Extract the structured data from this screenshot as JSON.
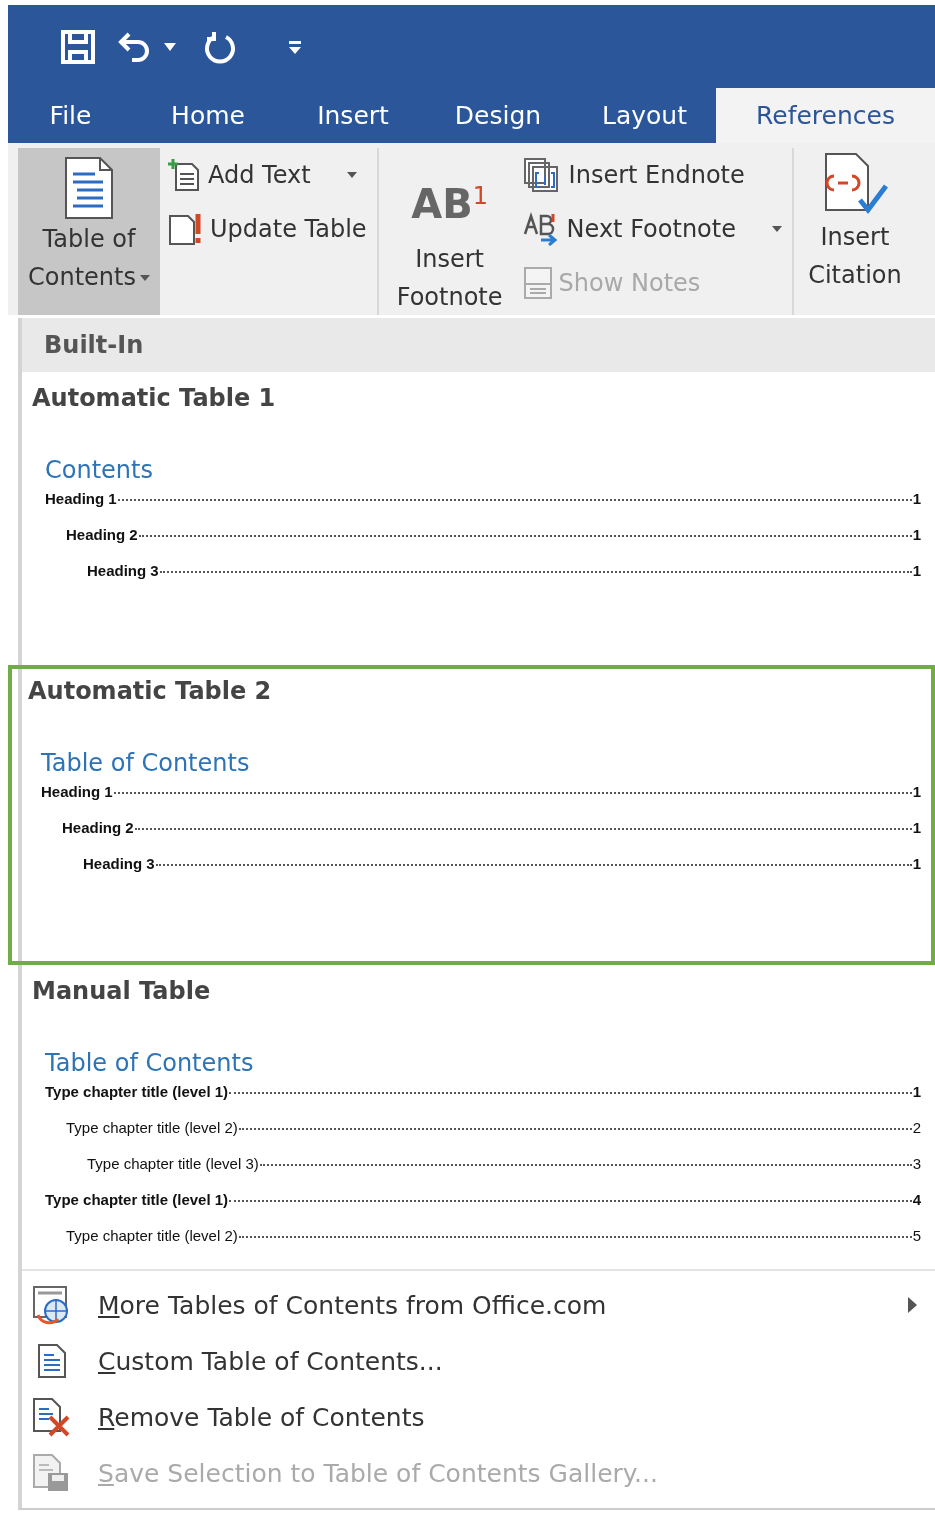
{
  "quick_access": [
    {
      "kind": "save"
    },
    {
      "kind": "undo"
    },
    {
      "kind": "undo-menu"
    },
    {
      "kind": "redo"
    },
    {
      "kind": "customize"
    }
  ],
  "tabs": [
    {
      "label": "File",
      "selected": false
    },
    {
      "label": "Home",
      "selected": false
    },
    {
      "label": "Insert",
      "selected": false
    },
    {
      "label": "Design",
      "selected": false
    },
    {
      "label": "Layout",
      "selected": false
    },
    {
      "label": "References",
      "selected": true
    }
  ],
  "ribbon": {
    "groups": [
      {
        "large": [
          {
            "kind": "toc",
            "label": "Table of Contents",
            "pressed": true,
            "dropdown": true
          }
        ],
        "small": [
          {
            "kind": "add-text",
            "label": "Add Text",
            "dropdown": true,
            "disabled": false
          },
          {
            "kind": "update",
            "label": "Update Table",
            "dropdown": false,
            "disabled": false
          }
        ]
      },
      {
        "large": [
          {
            "kind": "footnote",
            "icon_text": "AB$^{1}$",
            "label": "Insert Footnote",
            "pressed": false,
            "dropdown": false
          }
        ],
        "small": [
          {
            "kind": "endnote",
            "label": "Insert Endnote",
            "dropdown": false,
            "disabled": false
          },
          {
            "kind": "next-footnote",
            "label": "Next Footnote",
            "dropdown": true,
            "disabled": false
          },
          {
            "kind": "show-notes",
            "label": "Show Notes",
            "dropdown": false,
            "disabled": true
          }
        ]
      },
      {
        "large": [
          {
            "kind": "citation",
            "label": "Insert Citation",
            "pressed": false,
            "dropdown": false
          }
        ]
      }
    ]
  },
  "menu": {
    "section": "Built-In",
    "gallery": [
      {
        "title": "Automatic Table 1",
        "selected": false,
        "heading": "Contents",
        "entries": [
          {
            "text": "Heading 1",
            "page": "1",
            "bold": true,
            "children": [
              {
                "text": "Heading 2",
                "page": "1",
                "bold": true,
                "children": [
                  {
                    "text": "Heading 3",
                    "page": "1",
                    "bold": true
                  }
                ]
              }
            ]
          }
        ]
      },
      {
        "title": "Automatic Table 2",
        "selected": true,
        "heading": "Table of Contents",
        "entries": [
          {
            "text": "Heading 1",
            "page": "1",
            "bold": true,
            "children": [
              {
                "text": "Heading 2",
                "page": "1",
                "bold": true,
                "children": [
                  {
                    "text": "Heading 3",
                    "page": "1",
                    "bold": true
                  }
                ]
              }
            ]
          }
        ]
      },
      {
        "title": "Manual Table",
        "selected": false,
        "heading": "Table of Contents",
        "entries": [
          {
            "text": "Type chapter title (level 1)",
            "page": "1",
            "bold": true,
            "children": [
              {
                "text": "Type chapter title (level 2)",
                "page": "2",
                "bold": false,
                "children": [
                  {
                    "text": "Type chapter title (level 3)",
                    "page": "3",
                    "bold": false
                  }
                ]
              }
            ]
          },
          {
            "text": "Type chapter title (level 1)",
            "page": "4",
            "bold": true,
            "children": [
              {
                "text": "Type chapter title (level 2)",
                "page": "5",
                "bold": false
              }
            ]
          }
        ]
      }
    ],
    "commands": [
      {
        "kind": "web",
        "label": "More Tables of Contents from Office.com",
        "submenu": true,
        "disabled": false
      },
      {
        "kind": "custom",
        "label": "Custom Table of Contents...",
        "submenu": false,
        "disabled": false
      },
      {
        "kind": "remove",
        "label": "Remove Table of Contents",
        "submenu": false,
        "disabled": false
      },
      {
        "kind": "save-gallery",
        "label": "Save Selection to Table of Contents Gallery...",
        "submenu": false,
        "disabled": true
      }
    ]
  }
}
